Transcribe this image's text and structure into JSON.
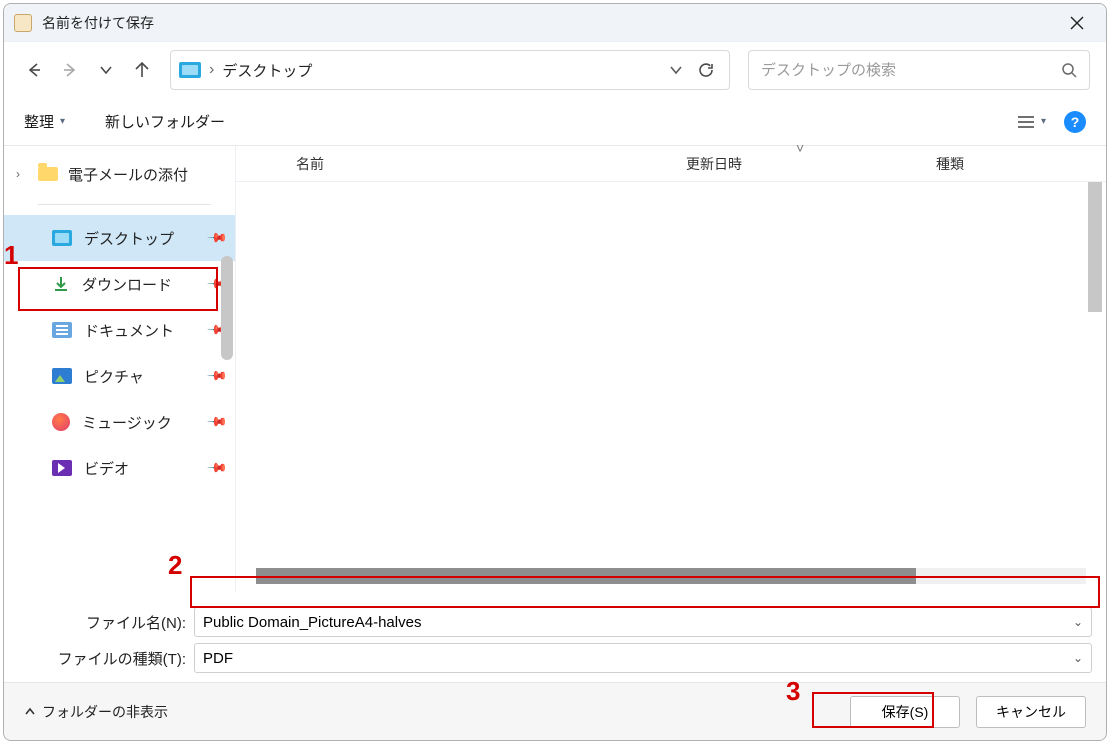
{
  "window": {
    "title": "名前を付けて保存"
  },
  "nav": {
    "breadcrumb": "デスクトップ",
    "search_placeholder": "デスクトップの検索"
  },
  "toolbar": {
    "organize": "整理",
    "new_folder": "新しいフォルダー"
  },
  "tree": {
    "email_attachments": "電子メールの添付"
  },
  "quick_access": {
    "items": [
      {
        "label": "デスクトップ",
        "icon": "desktop",
        "selected": true
      },
      {
        "label": "ダウンロード",
        "icon": "download",
        "selected": false
      },
      {
        "label": "ドキュメント",
        "icon": "doc",
        "selected": false
      },
      {
        "label": "ピクチャ",
        "icon": "pic",
        "selected": false
      },
      {
        "label": "ミュージック",
        "icon": "music",
        "selected": false
      },
      {
        "label": "ビデオ",
        "icon": "video",
        "selected": false
      }
    ]
  },
  "columns": {
    "name": "名前",
    "date": "更新日時",
    "type": "種類"
  },
  "fields": {
    "filename_label": "ファイル名(N):",
    "filename_value": "Public Domain_PictureA4-halves",
    "filetype_label": "ファイルの種類(T):",
    "filetype_value": "PDF"
  },
  "footer": {
    "toggle": "フォルダーの非表示",
    "save": "保存(S)",
    "cancel": "キャンセル"
  },
  "annotations": {
    "one": "1",
    "two": "2",
    "three": "3"
  }
}
